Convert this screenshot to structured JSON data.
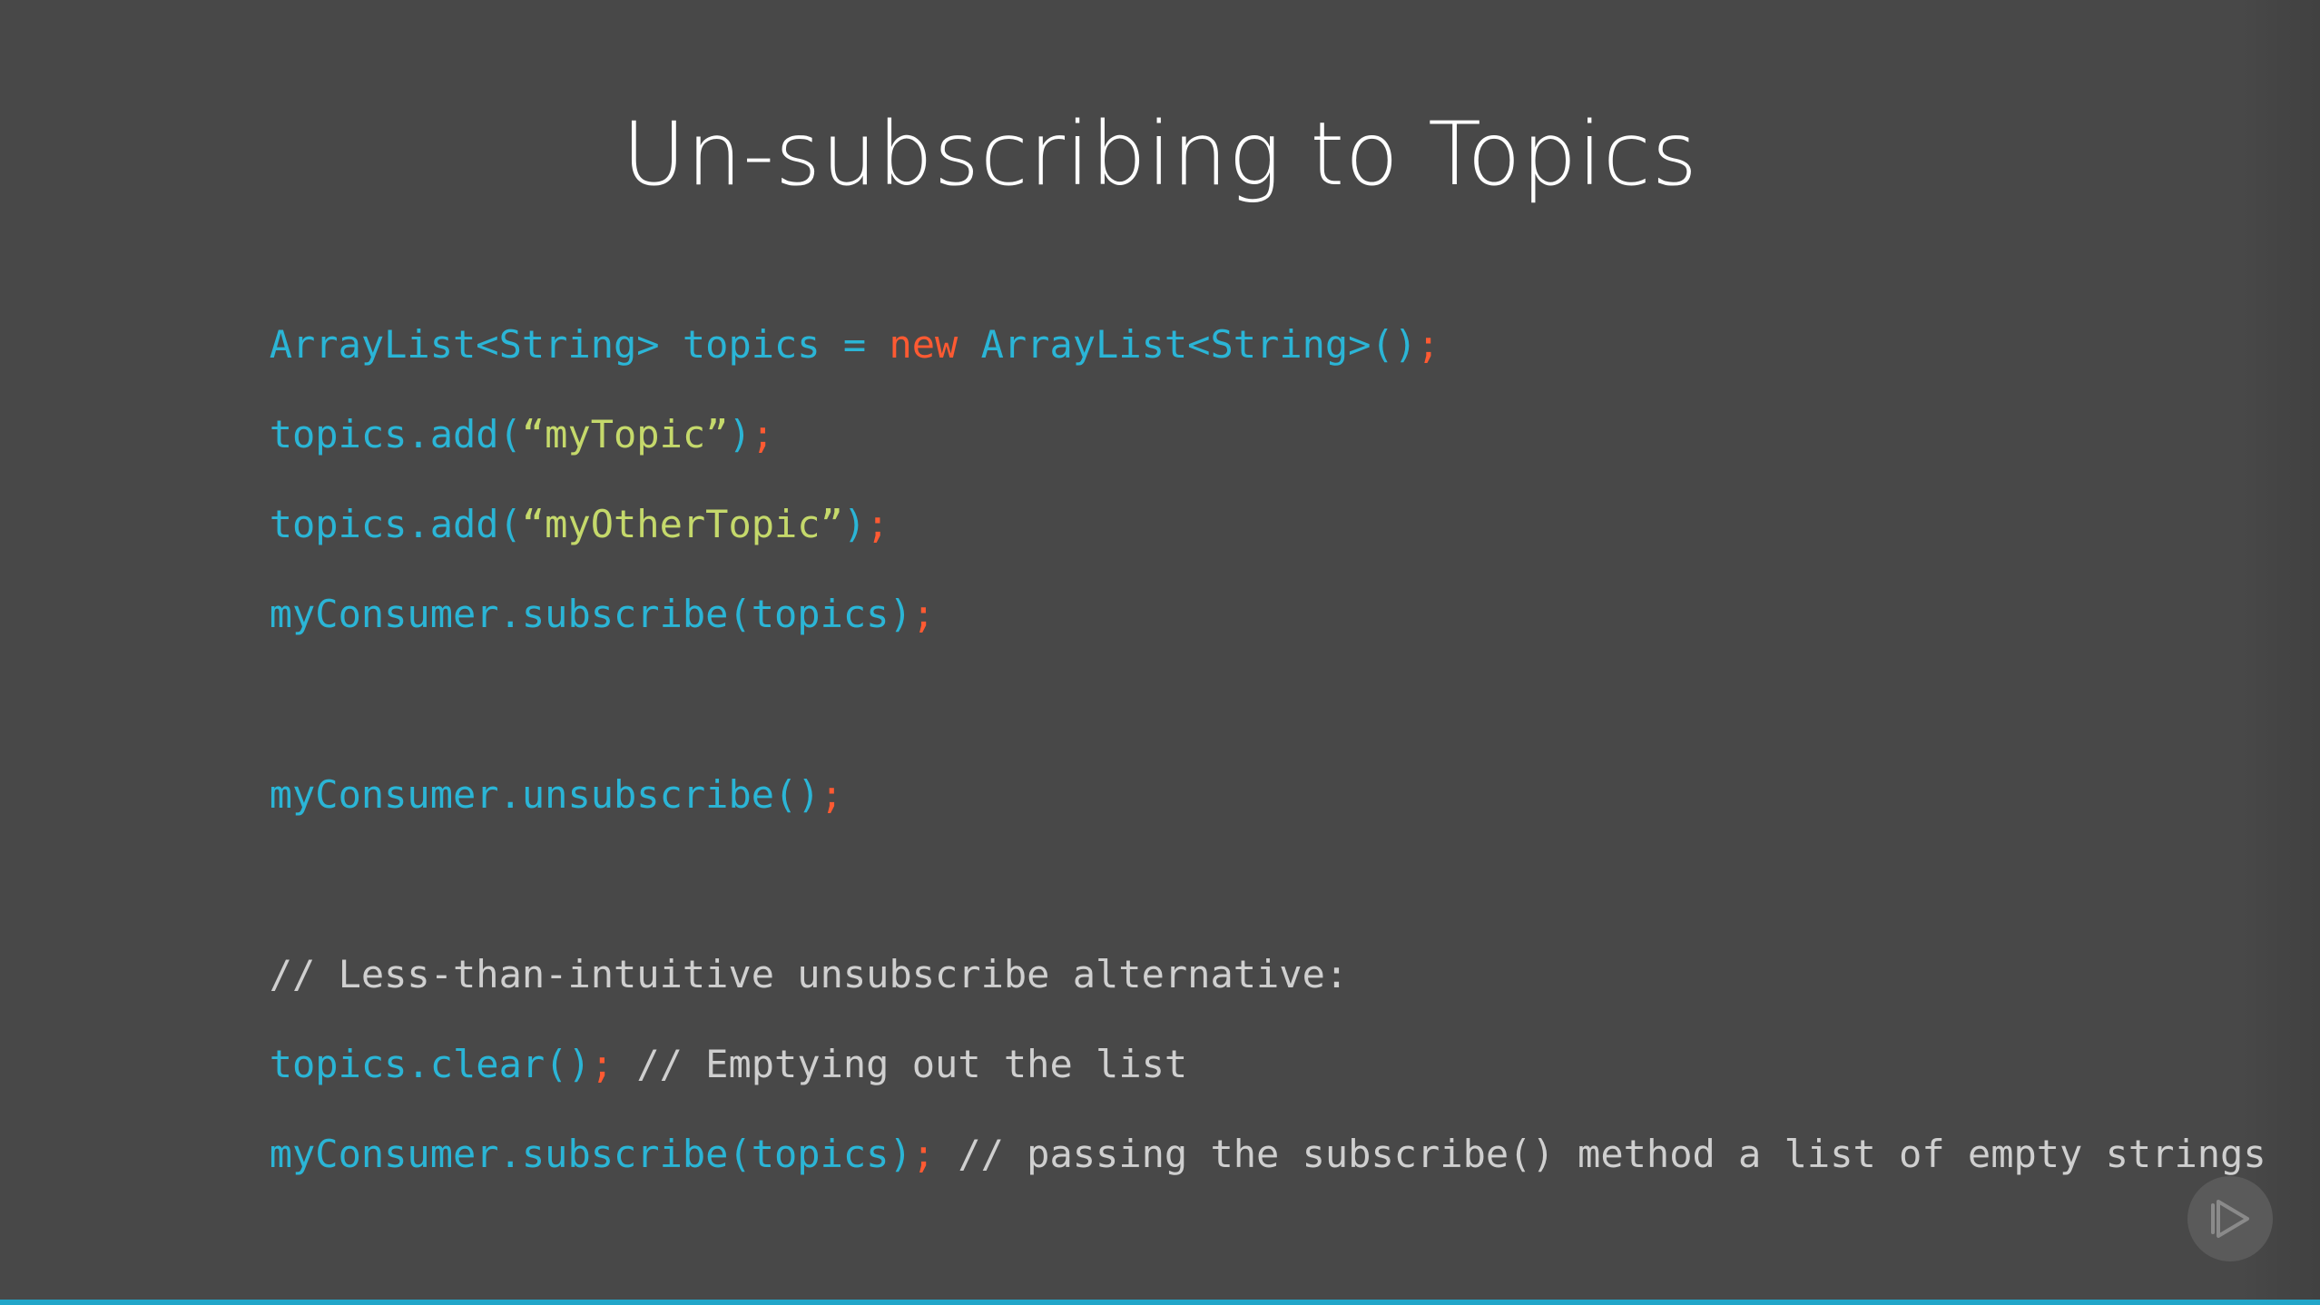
{
  "slide": {
    "title": "Un-subscribing to Topics"
  },
  "code": {
    "line1": {
      "t1": "ArrayList<String> topics = ",
      "t2": "new",
      "t3": " ArrayList<String>()",
      "t4": ";"
    },
    "line2": {
      "t1": "topics.add(",
      "t2": "“myTopic”",
      "t3": ")",
      "t4": ";"
    },
    "line3": {
      "t1": "topics.add(",
      "t2": "“myOtherTopic”",
      "t3": ")",
      "t4": ";"
    },
    "line4": {
      "t1": "myConsumer.subscribe(topics)",
      "t2": ";"
    },
    "line5": {
      "t1": "myConsumer.unsubscribe()",
      "t2": ";"
    },
    "line6": {
      "t1": "// Less-than-intuitive unsubscribe alternative:"
    },
    "line7": {
      "t1": "topics.clear()",
      "t2": ";",
      "t3": " // Emptying out the list"
    },
    "line8": {
      "t1": "myConsumer.subscribe(topics)",
      "t2": ";",
      "t3": " // passing the subscribe() method a list of empty strings"
    }
  },
  "controls": {
    "play_icon": "play-outline-icon"
  },
  "colors": {
    "background": "#484848",
    "identifier": "#2bb5d6",
    "keyword": "#ff5a32",
    "string": "#c5d96b",
    "comment": "#cfcfcf",
    "progress": "#22a6c9"
  }
}
